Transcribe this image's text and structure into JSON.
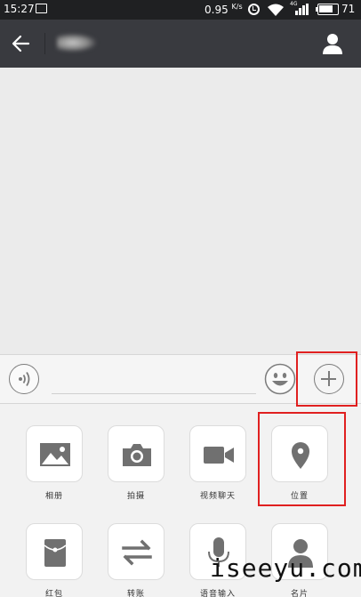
{
  "status_bar": {
    "time": "15:27",
    "speed": "0.95",
    "speed_unit": "K/s",
    "network": "4G",
    "battery": "71"
  },
  "header": {
    "chat_name": ""
  },
  "input_bar": {
    "text_value": ""
  },
  "tools": [
    {
      "label": "相册",
      "icon": "photo-album-icon"
    },
    {
      "label": "拍摄",
      "icon": "camera-icon"
    },
    {
      "label": "视频聊天",
      "icon": "video-call-icon"
    },
    {
      "label": "位置",
      "icon": "location-pin-icon"
    },
    {
      "label": "红包",
      "icon": "red-packet-icon"
    },
    {
      "label": "转账",
      "icon": "transfer-icon"
    },
    {
      "label": "语音输入",
      "icon": "microphone-icon"
    },
    {
      "label": "名片",
      "icon": "contact-card-icon"
    }
  ],
  "highlight_color": "#e02020",
  "watermark": "iseeyu.com"
}
